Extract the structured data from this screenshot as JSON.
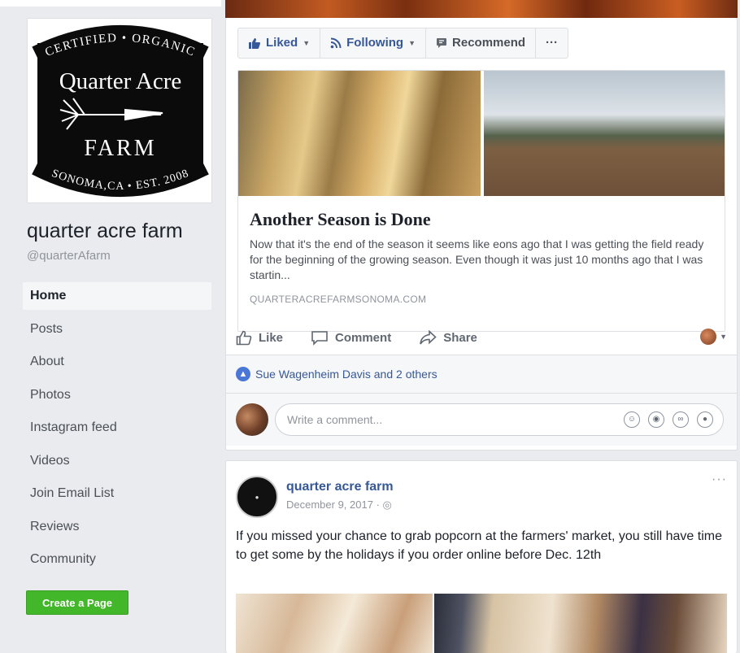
{
  "sidebar": {
    "logo": {
      "arc_top": "CERTIFIED • ORGANIC",
      "line1": "Quarter Acre",
      "line2": "FARM",
      "arc_bottom": "SONOMA,CA • EST. 2008"
    },
    "page_name": "quarter acre farm",
    "handle": "@quarterAfarm",
    "nav": [
      {
        "label": "Home"
      },
      {
        "label": "Posts"
      },
      {
        "label": "About"
      },
      {
        "label": "Photos"
      },
      {
        "label": "Instagram feed"
      },
      {
        "label": "Videos"
      },
      {
        "label": "Join Email List"
      },
      {
        "label": "Reviews"
      },
      {
        "label": "Community"
      }
    ],
    "create_page": "Create a Page"
  },
  "action_bar": {
    "liked": "Liked",
    "following": "Following",
    "recommend": "Recommend",
    "more": "···"
  },
  "post1": {
    "link": {
      "title": "Another Season is Done",
      "description": "Now that it's the end of the season it seems like eons ago that I was getting the field ready for the beginning of the growing season. Even though it was just 10 months ago that I was startin...",
      "domain": "QUARTERACREFARMSONOMA.COM"
    },
    "actions": {
      "like": "Like",
      "comment": "Comment",
      "share": "Share"
    },
    "likes_text": "Sue Wagenheim Davis and 2 others",
    "comment_placeholder": "Write a comment..."
  },
  "post2": {
    "author": "quarter acre farm",
    "date": "December 9, 2017 · ◎",
    "more": "···",
    "text": "If you missed your chance to grab popcorn at the farmers' market, you still have time to get some by the holidays if you order online before Dec. 12th"
  },
  "colors": {
    "link_blue": "#365899",
    "create_green": "#42b72a",
    "background": "#e9ebee"
  }
}
